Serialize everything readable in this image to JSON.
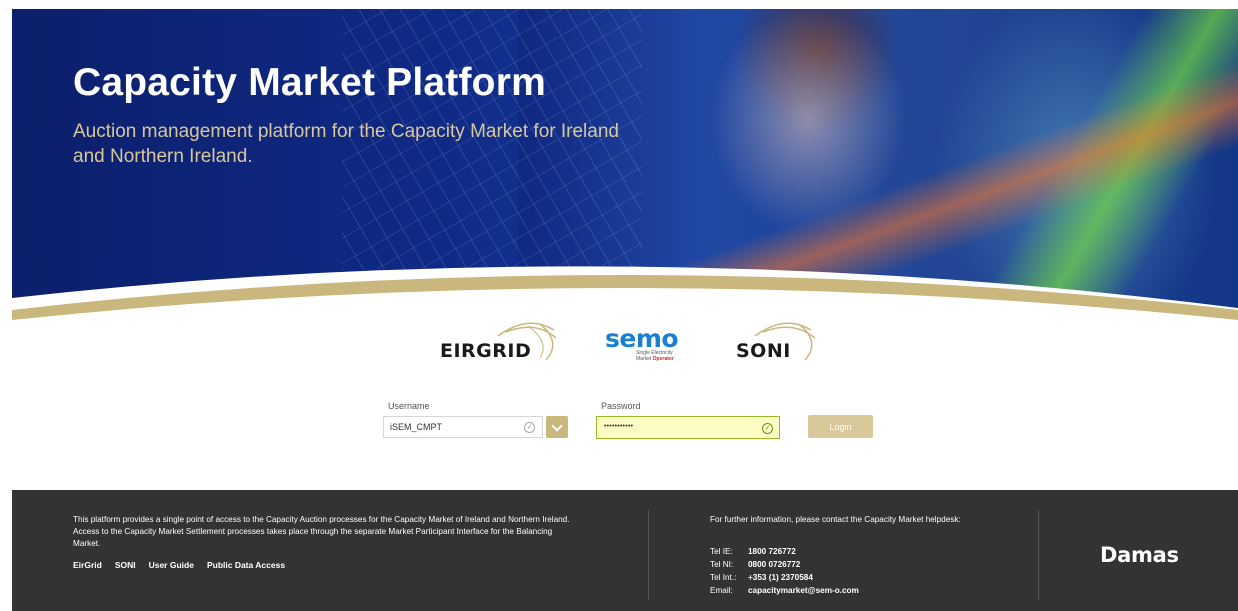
{
  "hero": {
    "title": "Capacity Market Platform",
    "subtitle": "Auction management platform for the Capacity Market for Ireland and Northern Ireland."
  },
  "logos": {
    "eirgrid": "EIRGRID",
    "semo": "semo",
    "semo_sub_line1": "Single Electricity",
    "semo_sub_line2a": "Market ",
    "semo_sub_line2b": "Operator",
    "soni": "SONI"
  },
  "login_form": {
    "username_label": "Username",
    "username_value": "iSEM_CMPT",
    "password_label": "Password",
    "password_value": "•••••••••••",
    "login_label": "Login"
  },
  "footer": {
    "description": "This platform provides a single point of access to the Capacity Auction processes for the Capacity Market of Ireland and Northern Ireland. Access to the Capacity Market Settlement processes takes place through the separate Market Participant Interface for the Balancing Market.",
    "links": [
      "EirGrid",
      "SONI",
      "User Guide",
      "Public Data Access"
    ],
    "contact_intro": "For further information, please contact the Capacity Market helpdesk:",
    "contacts": [
      {
        "key": "Tel IE:",
        "value": "1800 726772"
      },
      {
        "key": "Tel NI:",
        "value": "0800 0726772"
      },
      {
        "key": "Tel Int.:",
        "value": "+353 (1) 2370584"
      },
      {
        "key": "Email:",
        "value": "capacitymarket@sem-o.com"
      }
    ],
    "brand": "Damas"
  },
  "colors": {
    "hero_blue": "#0f2a86",
    "gold_accent": "#c9b77d",
    "footer_bg": "#333333",
    "password_bg": "#fbfcc4"
  }
}
